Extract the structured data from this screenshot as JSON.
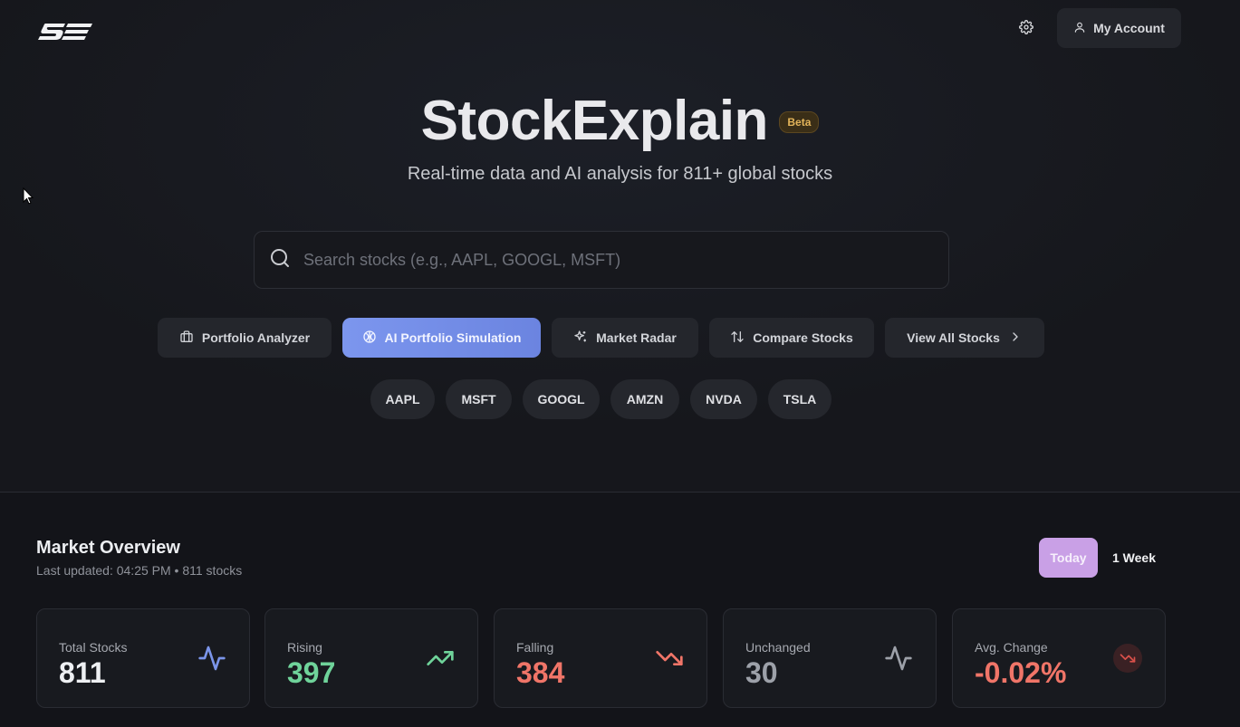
{
  "header": {
    "logo_icon": "se-logo-icon",
    "settings_icon": "gear-icon",
    "account_label": "My Account",
    "account_icon": "user-icon"
  },
  "hero": {
    "title": "StockExplain",
    "badge": "Beta",
    "subtitle": "Real-time data and AI analysis for 811+ global stocks"
  },
  "search": {
    "icon": "search-icon",
    "placeholder": "Search stocks (e.g., AAPL, GOOGL, MSFT)",
    "value": ""
  },
  "actions": [
    {
      "label": "Portfolio Analyzer",
      "icon": "briefcase-icon"
    },
    {
      "label": "AI Portfolio Simulation",
      "icon": "brain-icon",
      "active": true
    },
    {
      "label": "Market Radar",
      "icon": "sparkles-icon"
    },
    {
      "label": "Compare Stocks",
      "icon": "arrows-up-down-icon"
    },
    {
      "label": "View All Stocks",
      "icon": "chevron-right-icon"
    }
  ],
  "tickers": [
    "AAPL",
    "MSFT",
    "GOOGL",
    "AMZN",
    "NVDA",
    "TSLA"
  ],
  "market_overview": {
    "title": "Market Overview",
    "updated": "Last updated: 04:25 PM • 811 stocks",
    "toggle_today": "Today",
    "toggle_week": "1 Week",
    "active_period": "Today",
    "cards": [
      {
        "label": "Total Stocks",
        "value": "811",
        "icon": "activity-icon",
        "color": "#eef0f3",
        "icon_color": "#7b95ea"
      },
      {
        "label": "Rising",
        "value": "397",
        "icon": "trending-up-icon",
        "color": "#6fd39a",
        "icon_color": "#6fd39a"
      },
      {
        "label": "Falling",
        "value": "384",
        "icon": "trending-down-icon",
        "color": "#f07568",
        "icon_color": "#f07568"
      },
      {
        "label": "Unchanged",
        "value": "30",
        "icon": "activity-icon",
        "color": "#9da1a9",
        "icon_color": "#9da1a9"
      },
      {
        "label": "Avg. Change",
        "value": "-0.02%",
        "icon": "trending-down-icon",
        "color": "#f07568",
        "icon_color": "#d9504a"
      }
    ]
  },
  "colors": {
    "background": "#16171c",
    "accent": "#7b95ea",
    "beta": "#e3b45a",
    "today_active": "#c9a0e6"
  }
}
